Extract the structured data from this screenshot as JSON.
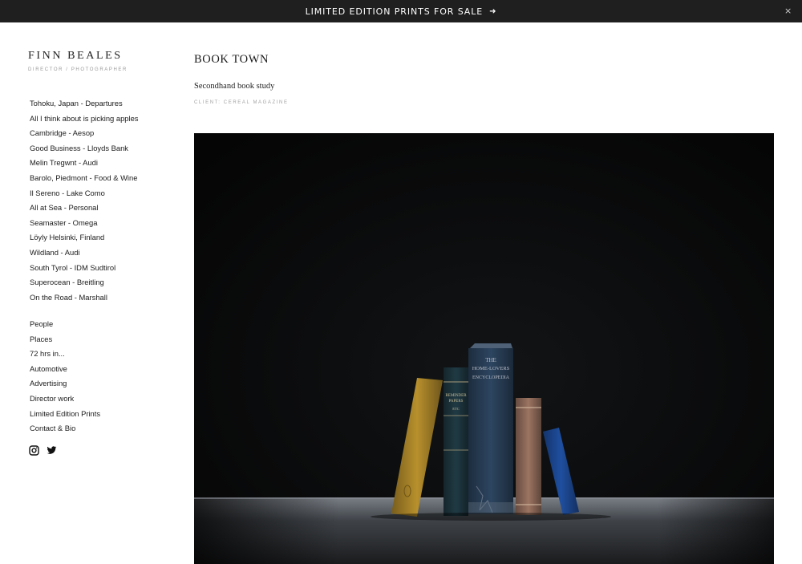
{
  "banner": {
    "text": "LIMITED EDITION PRINTS FOR SALE",
    "arrow_icon": "arrow-right-icon",
    "close_label": "×"
  },
  "site": {
    "title": "FINN BEALES",
    "subtitle": "DIRECTOR / PHOTOGRAPHER"
  },
  "nav": {
    "projects": [
      "Tohoku, Japan - Departures",
      "All I think about is picking apples",
      "Cambridge - Aesop",
      "Good Business - Lloyds Bank",
      "Melin Tregwnt - Audi",
      "Barolo, Piedmont - Food & Wine",
      "Il Sereno - Lake Como",
      "All at Sea - Personal",
      "Seamaster - Omega",
      "Löyly Helsinki, Finland",
      "Wildland - Audi",
      "South Tyrol - IDM Sudtirol",
      "Superocean - Breitling",
      "On the Road - Marshall"
    ],
    "categories": [
      "People",
      "Places",
      "72 hrs in...",
      "Automotive",
      "Advertising",
      "Director work",
      "Limited Edition Prints",
      "Contact & Bio"
    ]
  },
  "social": {
    "icons": [
      "instagram-icon",
      "twitter-icon"
    ]
  },
  "page": {
    "title": "BOOK TOWN",
    "description": "Secondhand book study",
    "client": "CLIENT: CEREAL MAGAZINE"
  },
  "photo": {
    "subject": "old books on a shelf",
    "spine_texts": {
      "encyclopedia": [
        "THE",
        "HOME-LOVERS",
        "ENCYCLOPEDIA"
      ],
      "papers": [
        "REMINDER",
        "PAPERS",
        "ETC"
      ]
    }
  },
  "colors": {
    "banner_bg": "#1f1f1f",
    "photo_bg": "#0a0a0a"
  }
}
